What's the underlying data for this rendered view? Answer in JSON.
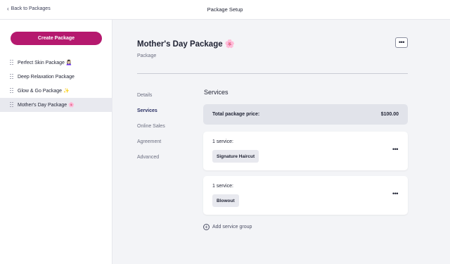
{
  "topbar": {
    "back_label": "Back to Packages",
    "back_icon": "chevron-left-icon",
    "title": "Package Setup"
  },
  "sidebar": {
    "create_label": "Create Package",
    "brand_color": "#b5196e",
    "items": [
      {
        "label": "Perfect Skin Package 💆🏻‍♀️",
        "active": false
      },
      {
        "label": "Deep Relaxation Package",
        "active": false
      },
      {
        "label": "Glow & Go Package ✨",
        "active": false
      },
      {
        "label": "Mother's Day Package 🌸",
        "active": true
      }
    ]
  },
  "main": {
    "title": "Mother's Day Package 🌸",
    "subtitle": "Package",
    "more_label": "•••",
    "nav": [
      {
        "label": "Details",
        "active": false
      },
      {
        "label": "Services",
        "active": true
      },
      {
        "label": "Online Sales",
        "active": false
      },
      {
        "label": "Agreement",
        "active": false
      },
      {
        "label": "Advanced",
        "active": false
      }
    ],
    "section_title": "Services",
    "total_label": "Total package price:",
    "total_value": "$100.00",
    "service_groups": [
      {
        "count_label": "1 service:",
        "service": "Signature Haircut",
        "more_label": "•••"
      },
      {
        "count_label": "1 service:",
        "service": "Blowout",
        "more_label": "•••"
      }
    ],
    "add_group_label": "Add service group"
  }
}
